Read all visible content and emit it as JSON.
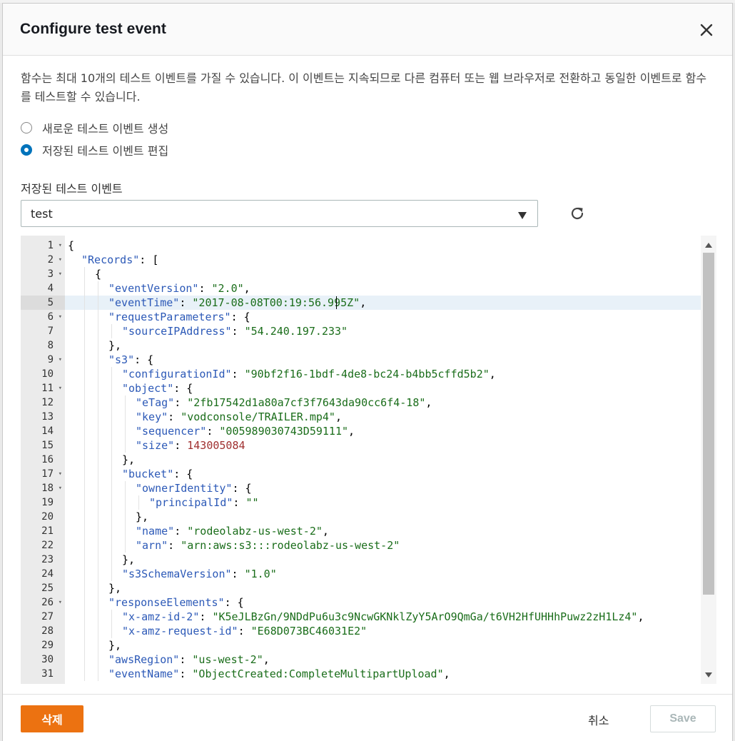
{
  "modal": {
    "title": "Configure test event",
    "close_icon": "close-icon"
  },
  "intro_text": "함수는 최대 10개의 테스트 이벤트를 가질 수 있습니다. 이 이벤트는 지속되므로 다른 컴퓨터 또는 웹 브라우저로 전환하고 동일한 이벤트로 함수를 테스트할 수 있습니다.",
  "radio_options": [
    {
      "label": "새로운 테스트 이벤트 생성",
      "checked": false
    },
    {
      "label": "저장된 테스트 이벤트 편집",
      "checked": true
    }
  ],
  "saved_events": {
    "label": "저장된 테스트 이벤트",
    "selected": "test",
    "refresh_icon": "refresh-icon"
  },
  "editor": {
    "active_line": 5,
    "lines": [
      {
        "n": 1,
        "fold": true,
        "indent": 0,
        "tokens": [
          [
            "p",
            "{"
          ]
        ]
      },
      {
        "n": 2,
        "fold": true,
        "indent": 1,
        "tokens": [
          [
            "k",
            "\"Records\""
          ],
          [
            "p",
            ": ["
          ]
        ]
      },
      {
        "n": 3,
        "fold": true,
        "indent": 2,
        "tokens": [
          [
            "p",
            "{"
          ]
        ]
      },
      {
        "n": 4,
        "fold": false,
        "indent": 3,
        "tokens": [
          [
            "k",
            "\"eventVersion\""
          ],
          [
            "p",
            ": "
          ],
          [
            "s",
            "\"2.0\""
          ],
          [
            "p",
            ","
          ]
        ]
      },
      {
        "n": 5,
        "fold": false,
        "indent": 3,
        "tokens": [
          [
            "k",
            "\"eventTime\""
          ],
          [
            "p",
            ": "
          ],
          [
            "s",
            "\"2017-08-08T00:19:56.995Z\""
          ],
          [
            "p",
            ","
          ]
        ]
      },
      {
        "n": 6,
        "fold": true,
        "indent": 3,
        "tokens": [
          [
            "k",
            "\"requestParameters\""
          ],
          [
            "p",
            ": {"
          ]
        ]
      },
      {
        "n": 7,
        "fold": false,
        "indent": 4,
        "tokens": [
          [
            "k",
            "\"sourceIPAddress\""
          ],
          [
            "p",
            ": "
          ],
          [
            "s",
            "\"54.240.197.233\""
          ]
        ]
      },
      {
        "n": 8,
        "fold": false,
        "indent": 3,
        "tokens": [
          [
            "p",
            "},"
          ]
        ]
      },
      {
        "n": 9,
        "fold": true,
        "indent": 3,
        "tokens": [
          [
            "k",
            "\"s3\""
          ],
          [
            "p",
            ": {"
          ]
        ]
      },
      {
        "n": 10,
        "fold": false,
        "indent": 4,
        "tokens": [
          [
            "k",
            "\"configurationId\""
          ],
          [
            "p",
            ": "
          ],
          [
            "s",
            "\"90bf2f16-1bdf-4de8-bc24-b4bb5cffd5b2\""
          ],
          [
            "p",
            ","
          ]
        ]
      },
      {
        "n": 11,
        "fold": true,
        "indent": 4,
        "tokens": [
          [
            "k",
            "\"object\""
          ],
          [
            "p",
            ": {"
          ]
        ]
      },
      {
        "n": 12,
        "fold": false,
        "indent": 5,
        "tokens": [
          [
            "k",
            "\"eTag\""
          ],
          [
            "p",
            ": "
          ],
          [
            "s",
            "\"2fb17542d1a80a7cf3f7643da90cc6f4-18\""
          ],
          [
            "p",
            ","
          ]
        ]
      },
      {
        "n": 13,
        "fold": false,
        "indent": 5,
        "tokens": [
          [
            "k",
            "\"key\""
          ],
          [
            "p",
            ": "
          ],
          [
            "s",
            "\"vodconsole/TRAILER.mp4\""
          ],
          [
            "p",
            ","
          ]
        ]
      },
      {
        "n": 14,
        "fold": false,
        "indent": 5,
        "tokens": [
          [
            "k",
            "\"sequencer\""
          ],
          [
            "p",
            ": "
          ],
          [
            "s",
            "\"005989030743D59111\""
          ],
          [
            "p",
            ","
          ]
        ]
      },
      {
        "n": 15,
        "fold": false,
        "indent": 5,
        "tokens": [
          [
            "k",
            "\"size\""
          ],
          [
            "p",
            ": "
          ],
          [
            "n",
            "143005084"
          ]
        ]
      },
      {
        "n": 16,
        "fold": false,
        "indent": 4,
        "tokens": [
          [
            "p",
            "},"
          ]
        ]
      },
      {
        "n": 17,
        "fold": true,
        "indent": 4,
        "tokens": [
          [
            "k",
            "\"bucket\""
          ],
          [
            "p",
            ": {"
          ]
        ]
      },
      {
        "n": 18,
        "fold": true,
        "indent": 5,
        "tokens": [
          [
            "k",
            "\"ownerIdentity\""
          ],
          [
            "p",
            ": {"
          ]
        ]
      },
      {
        "n": 19,
        "fold": false,
        "indent": 6,
        "tokens": [
          [
            "k",
            "\"principalId\""
          ],
          [
            "p",
            ": "
          ],
          [
            "s",
            "\"\""
          ]
        ]
      },
      {
        "n": 20,
        "fold": false,
        "indent": 5,
        "tokens": [
          [
            "p",
            "},"
          ]
        ]
      },
      {
        "n": 21,
        "fold": false,
        "indent": 5,
        "tokens": [
          [
            "k",
            "\"name\""
          ],
          [
            "p",
            ": "
          ],
          [
            "s",
            "\"rodeolabz-us-west-2\""
          ],
          [
            "p",
            ","
          ]
        ]
      },
      {
        "n": 22,
        "fold": false,
        "indent": 5,
        "tokens": [
          [
            "k",
            "\"arn\""
          ],
          [
            "p",
            ": "
          ],
          [
            "s",
            "\"arn:aws:s3:::rodeolabz-us-west-2\""
          ]
        ]
      },
      {
        "n": 23,
        "fold": false,
        "indent": 4,
        "tokens": [
          [
            "p",
            "},"
          ]
        ]
      },
      {
        "n": 24,
        "fold": false,
        "indent": 4,
        "tokens": [
          [
            "k",
            "\"s3SchemaVersion\""
          ],
          [
            "p",
            ": "
          ],
          [
            "s",
            "\"1.0\""
          ]
        ]
      },
      {
        "n": 25,
        "fold": false,
        "indent": 3,
        "tokens": [
          [
            "p",
            "},"
          ]
        ]
      },
      {
        "n": 26,
        "fold": true,
        "indent": 3,
        "tokens": [
          [
            "k",
            "\"responseElements\""
          ],
          [
            "p",
            ": {"
          ]
        ]
      },
      {
        "n": 27,
        "fold": false,
        "indent": 4,
        "tokens": [
          [
            "k",
            "\"x-amz-id-2\""
          ],
          [
            "p",
            ": "
          ],
          [
            "s",
            "\"K5eJLBzGn/9NDdPu6u3c9NcwGKNklZyY5ArO9QmGa/t6VH2HfUHHhPuwz2zH1Lz4\""
          ],
          [
            "p",
            ","
          ]
        ]
      },
      {
        "n": 28,
        "fold": false,
        "indent": 4,
        "tokens": [
          [
            "k",
            "\"x-amz-request-id\""
          ],
          [
            "p",
            ": "
          ],
          [
            "s",
            "\"E68D073BC46031E2\""
          ]
        ]
      },
      {
        "n": 29,
        "fold": false,
        "indent": 3,
        "tokens": [
          [
            "p",
            "},"
          ]
        ]
      },
      {
        "n": 30,
        "fold": false,
        "indent": 3,
        "tokens": [
          [
            "k",
            "\"awsRegion\""
          ],
          [
            "p",
            ": "
          ],
          [
            "s",
            "\"us-west-2\""
          ],
          [
            "p",
            ","
          ]
        ]
      },
      {
        "n": 31,
        "fold": false,
        "indent": 3,
        "tokens": [
          [
            "k",
            "\"eventName\""
          ],
          [
            "p",
            ": "
          ],
          [
            "s",
            "\"ObjectCreated:CompleteMultipartUpload\""
          ],
          [
            "p",
            ","
          ]
        ]
      }
    ]
  },
  "footer": {
    "delete_label": "삭제",
    "cancel_label": "취소",
    "save_label": "Save"
  },
  "colors": {
    "accent": "#ec7211",
    "radio_checked": "#0073bb",
    "json_key": "#2c59b7",
    "json_string": "#1a6d1a",
    "json_number": "#a03030"
  }
}
